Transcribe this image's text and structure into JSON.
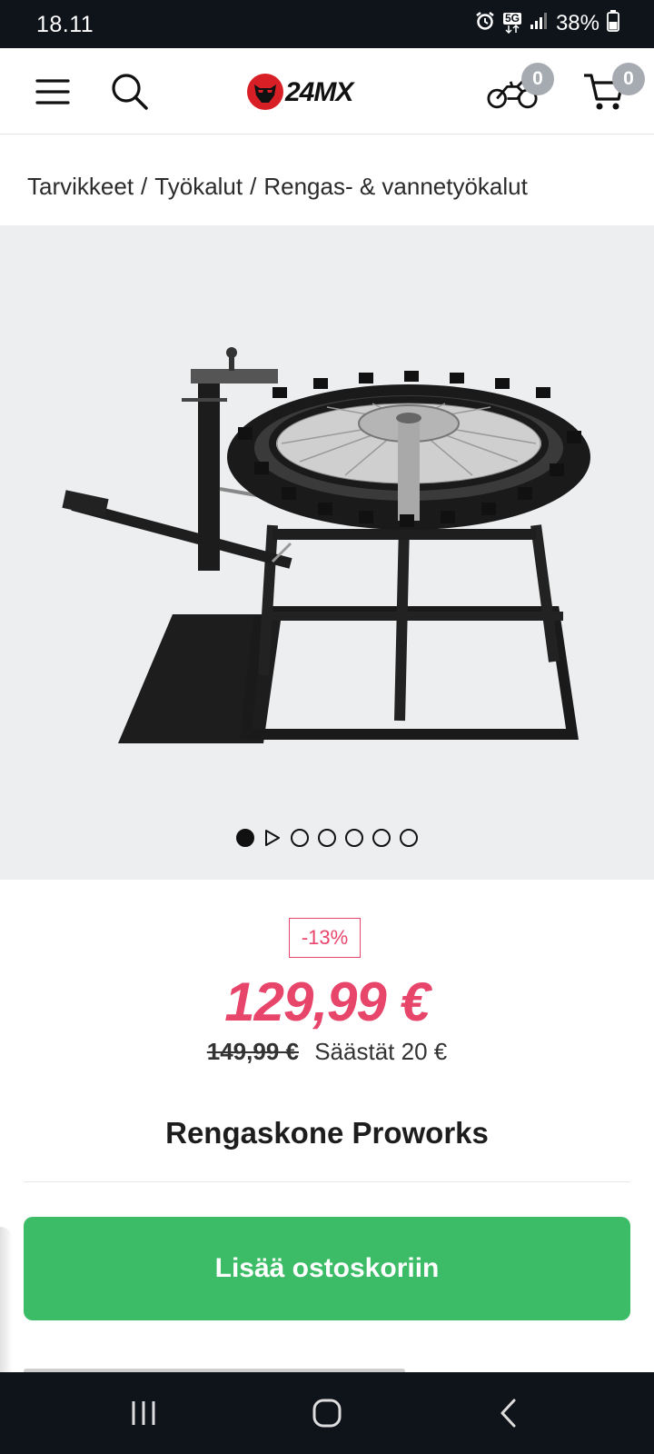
{
  "status": {
    "time": "18.11",
    "network": "5G",
    "battery": "38%"
  },
  "header": {
    "bike_count": "0",
    "cart_count": "0",
    "logo_text": "24MX"
  },
  "breadcrumb": {
    "items": [
      "Tarvikkeet",
      "Työkalut",
      "Rengas- & vannetyökalut"
    ],
    "separator": "/"
  },
  "gallery": {
    "image_alt": "Rengaskone Proworks",
    "slides": 7,
    "active_slide": 1
  },
  "product": {
    "discount": "-13%",
    "price": "129,99 €",
    "old_price": "149,99 €",
    "savings": "Säästät 20 €",
    "title": "Rengaskone Proworks",
    "add_to_cart": "Lisää ostoskoriin"
  },
  "colors": {
    "accent": "#e8456b",
    "cta": "#3dbc67",
    "statusbar": "#0f131a"
  }
}
